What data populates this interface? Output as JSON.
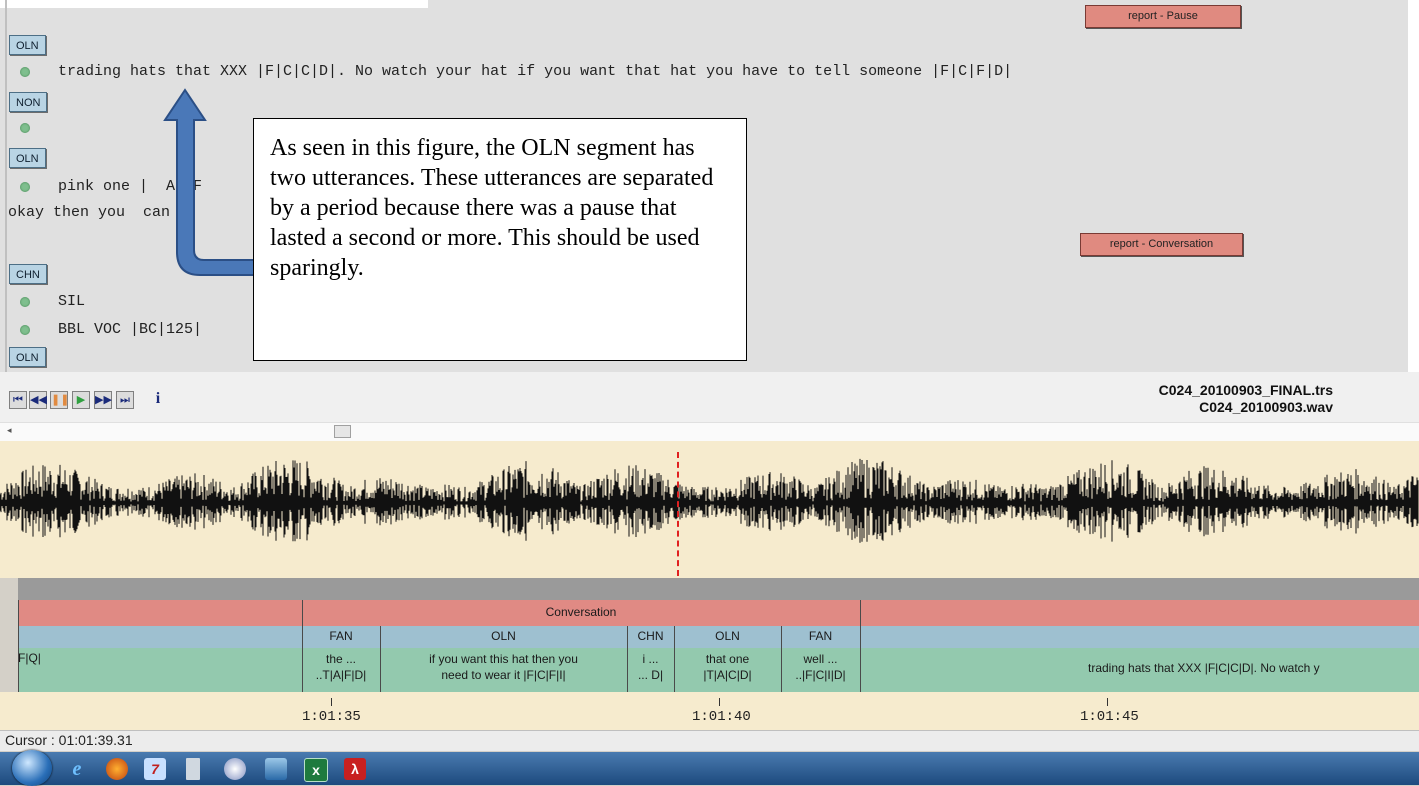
{
  "editor": {
    "speakers": [
      "OLN",
      "NON",
      "OLN",
      "CHN",
      "OLN"
    ],
    "lines": {
      "l1": "trading hats that XXX |F|C|C|D|. No watch your hat if you want that hat you have to tell someone |F|C|F|D|",
      "l3": "pink one |  A|UF",
      "l3b": "okay then you  can l",
      "l4": "SIL",
      "l5": "BBL VOC |BC|125|"
    },
    "buttons": {
      "pause": "report - Pause",
      "conversation": "report - Conversation"
    }
  },
  "callout": {
    "text": "As seen in this figure, the OLN segment has two utterances. These utterances are separated by a period because there was a pause that lasted a second or more. This should be used sparingly."
  },
  "toolbar": {
    "info_label": "i",
    "file1": "C024_20100903_FINAL.trs",
    "file2": "C024_20100903.wav"
  },
  "tiers": {
    "tier1_label": "Conversation",
    "speakers": [
      {
        "label": "FAN"
      },
      {
        "label": "OLN"
      },
      {
        "label": "CHN"
      },
      {
        "label": "OLN"
      },
      {
        "label": "FAN"
      }
    ],
    "segments": [
      {
        "line1": "F|Q|",
        "line2": ""
      },
      {
        "line1": "the ...",
        "line2": "..T|A|F|D|"
      },
      {
        "line1": "if you want this hat then you",
        "line2": "need to wear it |F|C|F|I|"
      },
      {
        "line1": "i ...",
        "line2": "... D|"
      },
      {
        "line1": "that one",
        "line2": "|T|A|C|D|"
      },
      {
        "line1": "well ...",
        "line2": "..|F|C|I|D|"
      },
      {
        "line1": "trading hats that XXX |F|C|C|D|. No watch y",
        "line2": ""
      }
    ]
  },
  "timeline": {
    "labels": [
      "1:01:35",
      "1:01:40",
      "1:01:45"
    ]
  },
  "status": {
    "cursor": "Cursor : 01:01:39.31"
  },
  "taskbar": {
    "icons": [
      "start-orb",
      "ie-icon",
      "firefox-icon",
      "transcriber-icon",
      "calculator-icon",
      "paint-icon",
      "explorer-icon",
      "excel-icon",
      "acrobat-icon"
    ]
  },
  "colors": {
    "tier1": "#e08a84",
    "tier2": "#9ec0d0",
    "tier3": "#93c9ae",
    "wave_bg": "#f6ebce",
    "cursor": "#e02020"
  }
}
